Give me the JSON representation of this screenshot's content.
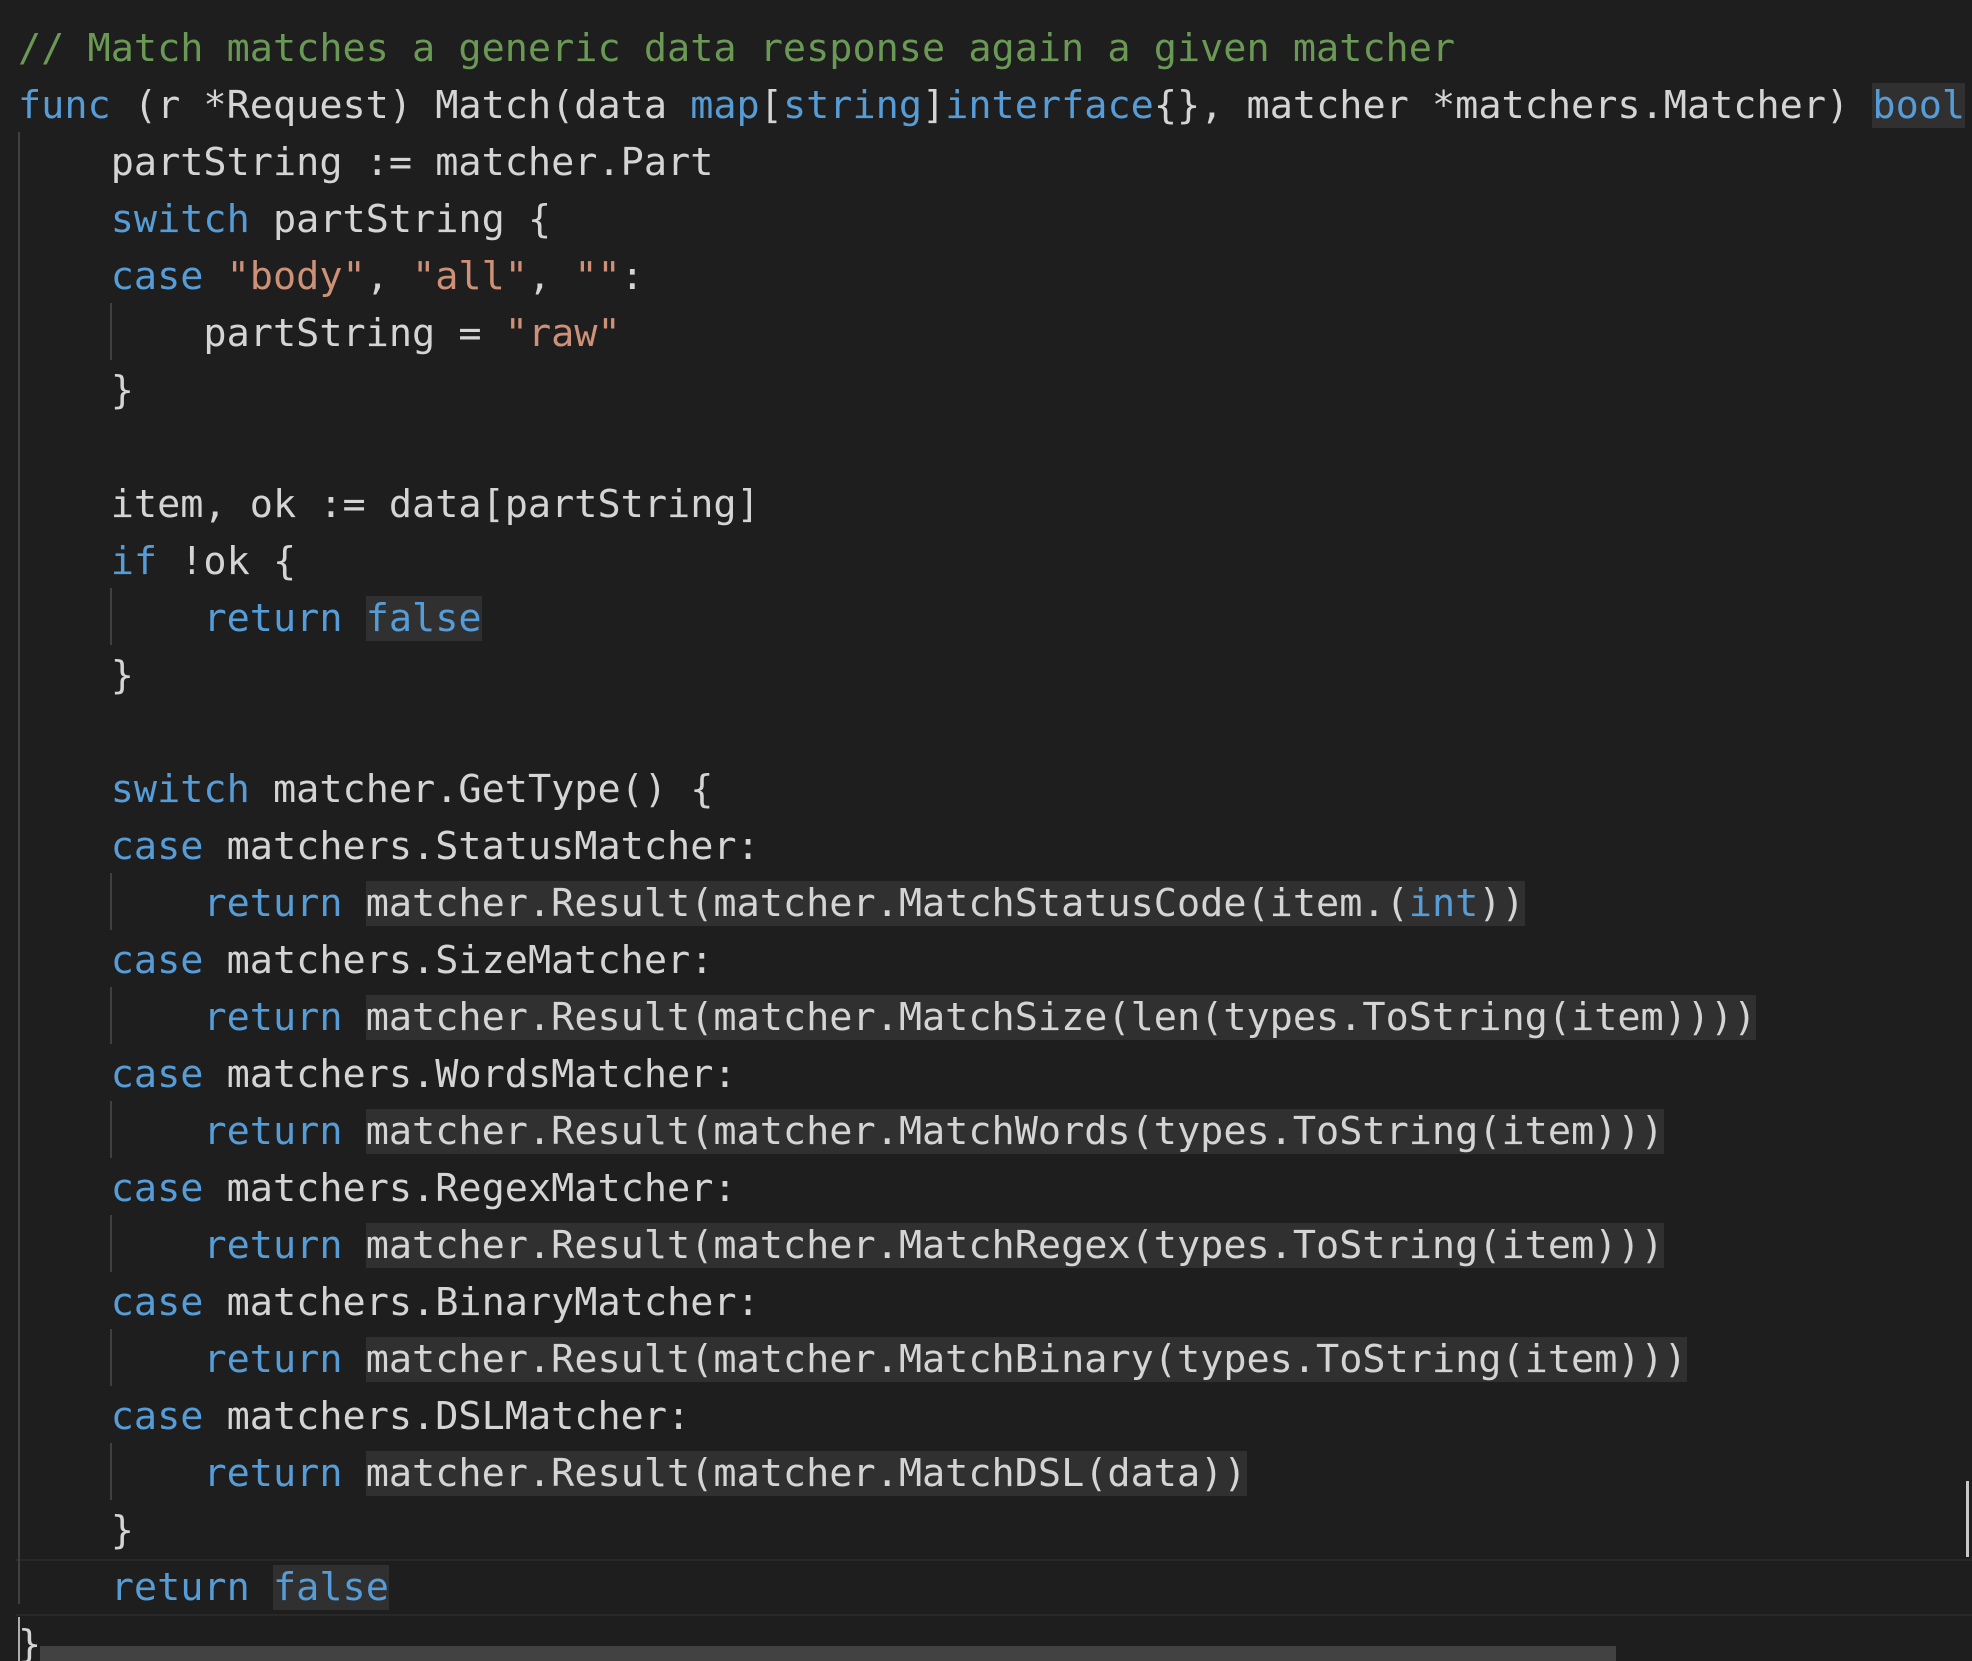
{
  "editor": {
    "language": "go",
    "colors": {
      "background": "#1e1e1e",
      "comment": "#6a9955",
      "keyword": "#569cd6",
      "string": "#ce9178",
      "text": "#d4d4d4",
      "highlight": "#303031",
      "indent_guide": "#404040"
    },
    "lines": [
      [
        {
          "t": "// Match matches a generic data response again a given matcher",
          "c": "comment"
        }
      ],
      [
        {
          "t": "func",
          "c": "keyword"
        },
        {
          "t": " (r *Request) Match(data "
        },
        {
          "t": "map",
          "c": "keyword"
        },
        {
          "t": "["
        },
        {
          "t": "string",
          "c": "keyword"
        },
        {
          "t": "]"
        },
        {
          "t": "interface",
          "c": "keyword"
        },
        {
          "t": "{}, matcher *matchers.Matcher) "
        },
        {
          "t": "bool",
          "c": "keyword",
          "hl": true
        }
      ],
      [
        {
          "t": "    partString := matcher.Part"
        }
      ],
      [
        {
          "t": "    "
        },
        {
          "t": "switch",
          "c": "keyword"
        },
        {
          "t": " partString {"
        }
      ],
      [
        {
          "t": "    "
        },
        {
          "t": "case",
          "c": "keyword"
        },
        {
          "t": " "
        },
        {
          "t": "\"body\"",
          "c": "string"
        },
        {
          "t": ", "
        },
        {
          "t": "\"all\"",
          "c": "string"
        },
        {
          "t": ", "
        },
        {
          "t": "\"\"",
          "c": "string"
        },
        {
          "t": ":"
        }
      ],
      [
        {
          "t": "        partString = "
        },
        {
          "t": "\"raw\"",
          "c": "string"
        }
      ],
      [
        {
          "t": "    }"
        }
      ],
      [],
      [
        {
          "t": "    item, ok := data[partString]"
        }
      ],
      [
        {
          "t": "    "
        },
        {
          "t": "if",
          "c": "keyword"
        },
        {
          "t": " !ok {"
        }
      ],
      [
        {
          "t": "        "
        },
        {
          "t": "return",
          "c": "keyword"
        },
        {
          "t": " "
        },
        {
          "t": "false",
          "c": "keyword",
          "hl": true
        }
      ],
      [
        {
          "t": "    }"
        }
      ],
      [],
      [
        {
          "t": "    "
        },
        {
          "t": "switch",
          "c": "keyword"
        },
        {
          "t": " matcher.GetType() {"
        }
      ],
      [
        {
          "t": "    "
        },
        {
          "t": "case",
          "c": "keyword"
        },
        {
          "t": " matchers.StatusMatcher:"
        }
      ],
      [
        {
          "t": "        "
        },
        {
          "t": "return",
          "c": "keyword"
        },
        {
          "t": " "
        },
        {
          "t": "matcher.Result(matcher.MatchStatusCode(item.(",
          "hl": true
        },
        {
          "t": "int",
          "c": "keyword",
          "hl": true
        },
        {
          "t": "))",
          "hl": true
        }
      ],
      [
        {
          "t": "    "
        },
        {
          "t": "case",
          "c": "keyword"
        },
        {
          "t": " matchers.SizeMatcher:"
        }
      ],
      [
        {
          "t": "        "
        },
        {
          "t": "return",
          "c": "keyword"
        },
        {
          "t": " "
        },
        {
          "t": "matcher.Result(matcher.MatchSize(len(types.ToString(item))))",
          "hl": true
        }
      ],
      [
        {
          "t": "    "
        },
        {
          "t": "case",
          "c": "keyword"
        },
        {
          "t": " matchers.WordsMatcher:"
        }
      ],
      [
        {
          "t": "        "
        },
        {
          "t": "return",
          "c": "keyword"
        },
        {
          "t": " "
        },
        {
          "t": "matcher.Result(matcher.MatchWords(types.ToString(item)))",
          "hl": true
        }
      ],
      [
        {
          "t": "    "
        },
        {
          "t": "case",
          "c": "keyword"
        },
        {
          "t": " matchers.RegexMatcher:"
        }
      ],
      [
        {
          "t": "        "
        },
        {
          "t": "return",
          "c": "keyword"
        },
        {
          "t": " "
        },
        {
          "t": "matcher.Result(matcher.MatchRegex(types.ToString(item)))",
          "hl": true
        }
      ],
      [
        {
          "t": "    "
        },
        {
          "t": "case",
          "c": "keyword"
        },
        {
          "t": " matchers.BinaryMatcher:"
        }
      ],
      [
        {
          "t": "        "
        },
        {
          "t": "return",
          "c": "keyword"
        },
        {
          "t": " "
        },
        {
          "t": "matcher.Result(matcher.MatchBinary(types.ToString(item)))",
          "hl": true
        }
      ],
      [
        {
          "t": "    "
        },
        {
          "t": "case",
          "c": "keyword"
        },
        {
          "t": " matchers.DSLMatcher:"
        }
      ],
      [
        {
          "t": "        "
        },
        {
          "t": "return",
          "c": "keyword"
        },
        {
          "t": " "
        },
        {
          "t": "matcher.Result(matcher.MatchDSL(data))",
          "hl": true
        }
      ],
      [
        {
          "t": "    }"
        }
      ],
      [
        {
          "t": "    "
        },
        {
          "t": "return",
          "c": "keyword"
        },
        {
          "t": " "
        },
        {
          "t": "false",
          "c": "keyword",
          "hl": true
        }
      ],
      [
        {
          "t": "}"
        }
      ]
    ],
    "current_line": 27
  }
}
